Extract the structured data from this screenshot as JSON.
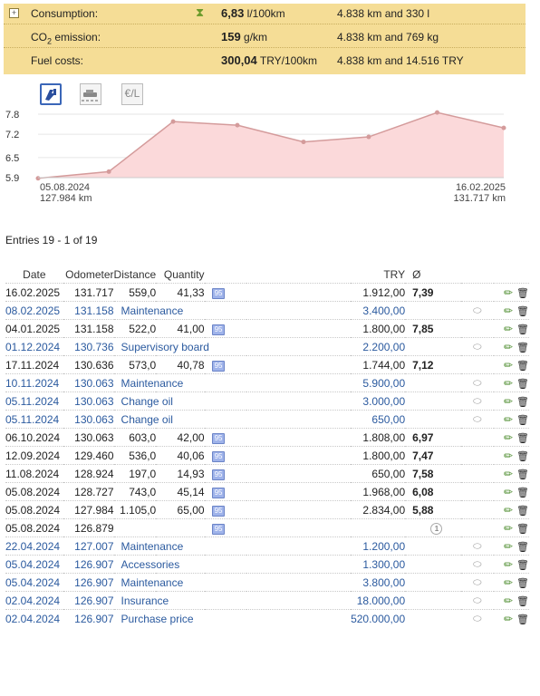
{
  "summary": {
    "expand_icon": "plus-box-icon",
    "rows": [
      {
        "label": "Consumption:",
        "value": "6,83",
        "unit": "l/100km",
        "info": "4.838 km and 330 l"
      },
      {
        "label_main": "CO",
        "label_sub": "2",
        "label_rest": " emission:",
        "value": "159",
        "unit": "g/km",
        "info": "4.838 km and 769 kg"
      },
      {
        "label": "Fuel costs:",
        "value": "300,04",
        "unit": "TRY/100km",
        "info": "4.838 km and 14.516 TRY"
      }
    ]
  },
  "chart_icons": [
    "fuel-pump-icon",
    "car-road-icon",
    "euro-per-liter-icon"
  ],
  "chart_icon_text": {
    "euro": "€/L"
  },
  "chart_data": {
    "type": "area",
    "y_ticks": [
      "7.8",
      "7.2",
      "6.5",
      "5.9"
    ],
    "ylim": [
      5.9,
      7.8
    ],
    "values": [
      5.88,
      6.08,
      7.58,
      7.47,
      6.97,
      7.12,
      7.85,
      7.39
    ],
    "x_start_date": "05.08.2024",
    "x_start_km": "127.984 km",
    "x_end_date": "16.02.2025",
    "x_end_km": "131.717 km",
    "line_color": "#d49b9b",
    "fill_color": "#fbd9da"
  },
  "entries_count": "Entries 19 - 1 of 19",
  "columns": {
    "date": "Date",
    "odometer": "Odometer",
    "distance": "Distance",
    "quantity": "Quantity",
    "currency": "TRY",
    "avg": "Ø"
  },
  "fuel_badge": "95",
  "rows": [
    {
      "type": "fuel",
      "date": "16.02.2025",
      "odo": "131.717",
      "dist": "559,0",
      "qty": "41,33",
      "cost": "1.912,00",
      "avg": "7,39"
    },
    {
      "type": "cost",
      "date": "08.02.2025",
      "odo": "131.158",
      "note": "Maintenance",
      "cost": "3.400,00",
      "comment": true
    },
    {
      "type": "fuel",
      "date": "04.01.2025",
      "odo": "131.158",
      "dist": "522,0",
      "qty": "41,00",
      "cost": "1.800,00",
      "avg": "7,85"
    },
    {
      "type": "cost",
      "date": "01.12.2024",
      "odo": "130.736",
      "note": "Supervisory board",
      "cost": "2.200,00",
      "comment": true
    },
    {
      "type": "fuel",
      "date": "17.11.2024",
      "odo": "130.636",
      "dist": "573,0",
      "qty": "40,78",
      "cost": "1.744,00",
      "avg": "7,12"
    },
    {
      "type": "cost",
      "date": "10.11.2024",
      "odo": "130.063",
      "note": "Maintenance",
      "cost": "5.900,00",
      "comment": true
    },
    {
      "type": "cost",
      "date": "05.11.2024",
      "odo": "130.063",
      "note": "Change oil",
      "cost": "3.000,00",
      "comment": true
    },
    {
      "type": "cost",
      "date": "05.11.2024",
      "odo": "130.063",
      "note": "Change oil",
      "cost": "650,00",
      "comment": true
    },
    {
      "type": "fuel",
      "date": "06.10.2024",
      "odo": "130.063",
      "dist": "603,0",
      "qty": "42,00",
      "cost": "1.808,00",
      "avg": "6,97"
    },
    {
      "type": "fuel",
      "date": "12.09.2024",
      "odo": "129.460",
      "dist": "536,0",
      "qty": "40,06",
      "cost": "1.800,00",
      "avg": "7,47"
    },
    {
      "type": "fuel",
      "date": "11.08.2024",
      "odo": "128.924",
      "dist": "197,0",
      "qty": "14,93",
      "cost": "650,00",
      "avg": "7,58"
    },
    {
      "type": "fuel",
      "date": "05.08.2024",
      "odo": "128.727",
      "dist": "743,0",
      "qty": "45,14",
      "cost": "1.968,00",
      "avg": "6,08"
    },
    {
      "type": "fuel",
      "date": "05.08.2024",
      "odo": "127.984",
      "dist": "1.105,0",
      "qty": "65,00",
      "cost": "2.834,00",
      "avg": "5,88"
    },
    {
      "type": "fuel",
      "date": "05.08.2024",
      "odo": "126.879",
      "dist": "",
      "qty": "",
      "cost": "",
      "avg": "",
      "circle": "1"
    },
    {
      "type": "cost",
      "date": "22.04.2024",
      "odo": "127.007",
      "note": "Maintenance",
      "cost": "1.200,00",
      "comment": true
    },
    {
      "type": "cost",
      "date": "05.04.2024",
      "odo": "126.907",
      "note": "Accessories",
      "cost": "1.300,00",
      "comment": true
    },
    {
      "type": "cost",
      "date": "05.04.2024",
      "odo": "126.907",
      "note": "Maintenance",
      "cost": "3.800,00",
      "comment": true
    },
    {
      "type": "cost",
      "date": "02.04.2024",
      "odo": "126.907",
      "note": "Insurance",
      "cost": "18.000,00",
      "comment": true
    },
    {
      "type": "cost",
      "date": "02.04.2024",
      "odo": "126.907",
      "note": "Purchase price",
      "cost": "520.000,00",
      "comment": true
    }
  ]
}
